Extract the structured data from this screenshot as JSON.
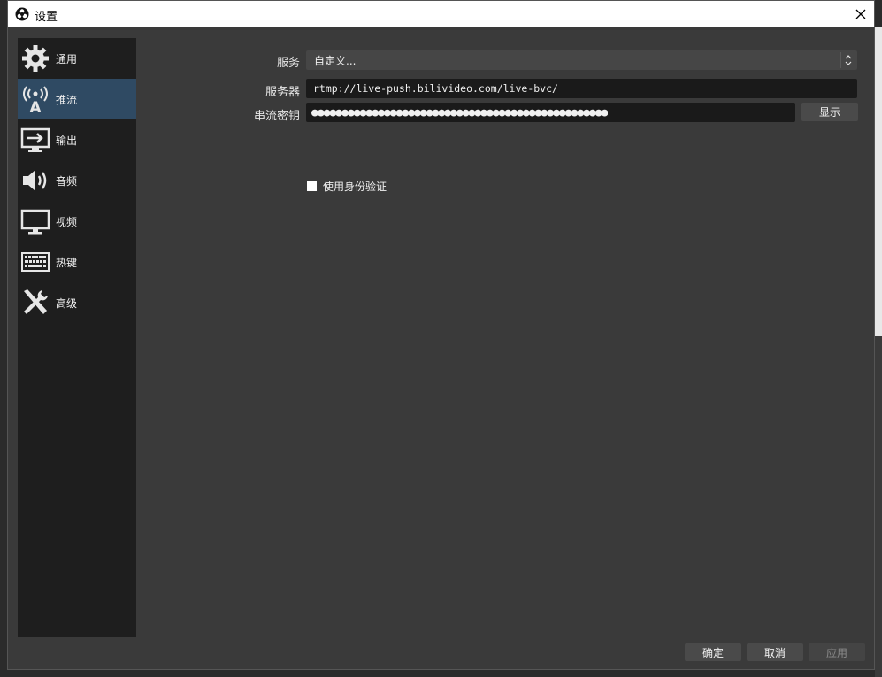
{
  "window": {
    "title": "设置",
    "close_label": "×"
  },
  "sidebar": {
    "items": [
      {
        "label": "通用",
        "icon": "gear-icon"
      },
      {
        "label": "推流",
        "icon": "broadcast-antenna-icon",
        "active": true
      },
      {
        "label": "输出",
        "icon": "output-monitor-icon"
      },
      {
        "label": "音频",
        "icon": "speaker-icon"
      },
      {
        "label": "视频",
        "icon": "monitor-icon"
      },
      {
        "label": "热键",
        "icon": "keyboard-icon"
      },
      {
        "label": "高级",
        "icon": "tools-icon"
      }
    ]
  },
  "stream": {
    "service_label": "服务",
    "service_value": "自定义...",
    "server_label": "服务器",
    "server_value": "rtmp://live-push.bilivideo.com/live-bvc/",
    "key_label": "串流密钥",
    "key_masked": "●●●●●●●●●●●●●●●●●●●●●●●●●●●●●●●●●●●●●●●●●●●●●●●●●",
    "show_button": "显示",
    "auth_checkbox_label": "使用身份验证",
    "auth_checked": false
  },
  "footer": {
    "ok": "确定",
    "cancel": "取消",
    "apply": "应用"
  },
  "colors": {
    "window_bg": "#3a3a3a",
    "sidebar_bg": "#1e1e1e",
    "active_item": "#2f4a63",
    "field_bg": "#1a1a1a"
  }
}
